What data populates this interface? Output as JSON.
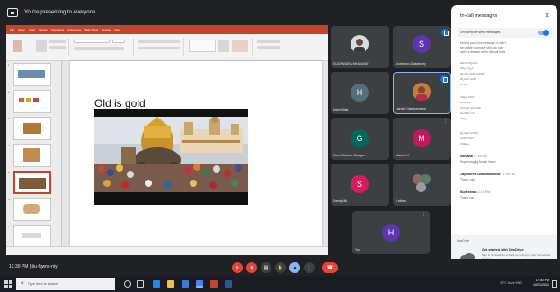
{
  "present_bar": {
    "text": "You're presenting to everyone"
  },
  "ppt": {
    "tabs": [
      "File",
      "Home",
      "Insert",
      "Design",
      "Transitions",
      "Animations",
      "Slide Show",
      "Review",
      "View"
    ],
    "thumb_numbers": [
      "1",
      "2",
      "3",
      "4",
      "5",
      "6",
      "7"
    ],
    "slide_title": "Old is gold"
  },
  "tiles": [
    {
      "id": "tile-0",
      "type": "photo",
      "name": "SUCHANDRA BHAGAVATI",
      "avatar_letter": "",
      "avatar_color": ""
    },
    {
      "id": "tile-1",
      "type": "letter",
      "name": "Sudeshna Chakraborty",
      "avatar_letter": "S",
      "avatar_color": "#5e35b1",
      "mic": true
    },
    {
      "id": "tile-2",
      "type": "letter",
      "name": "Harini Bhat",
      "avatar_letter": "H",
      "avatar_color": "#546e7a"
    },
    {
      "id": "tile-3",
      "type": "photo",
      "name": "Janaki Chandrashekar",
      "avatar_letter": "",
      "avatar_color": "",
      "mic": true,
      "highlight": true
    },
    {
      "id": "tile-4",
      "type": "letter",
      "name": "Gowri Shankar Bhargav",
      "avatar_letter": "G",
      "avatar_color": "#00695c"
    },
    {
      "id": "tile-5",
      "type": "letter",
      "name": "Mahesh K",
      "avatar_letter": "M",
      "avatar_color": "#c2185b"
    },
    {
      "id": "tile-6",
      "type": "letter",
      "name": "Sanay Nik",
      "avatar_letter": "S",
      "avatar_color": "#d81b60"
    },
    {
      "id": "tile-7",
      "type": "group",
      "name": "3 others",
      "avatar_letter": "",
      "avatar_color": ""
    },
    {
      "id": "tile-8",
      "type": "letter",
      "name": "You",
      "avatar_letter": "H",
      "avatar_color": "#5e35b1"
    }
  ],
  "chat": {
    "title": "In-call messages",
    "toggle_label": "Let everyone send messages",
    "messages_a": [
      "Unless you pin a message, it won't",
      "be visible to people who join later",
      "and it's deleted when the call ends"
    ],
    "messages_b": [
      "ಹಳೆಯ ಪದ್ಧತಿಗಳು",
      "ನಮ್ಮ ಸಂಸ್ಕೃತಿ",
      "ಹಬ್ಬಗಳು ಮತ್ತು ಆಚರಣೆ",
      "ಮೈಸೂರು ದಸರಾ",
      "ಅಂಬಾರಿ"
    ],
    "messages_c": [
      "ಜಮ್ಬೂ ಸವಾರಿ",
      "ಕಲಾವಿದರು",
      "ಗೋಲ್ಡನ್ ಚಾರಿಯಟ್",
      "ಸಾವಿರಾರು ಜನ",
      "ಹೆಮ್ಮೆ"
    ],
    "messages_d": [
      "ಮೈಸೂರು ಅರಮನೆ",
      "ದೀಪಾಲಂಕಾರ",
      "ನಾಡಹಬ್ಬ"
    ],
    "entries": [
      {
        "sender": "Sanjana",
        "time": "11:16 PM",
        "text": "Super singing buddy Harini"
      },
      {
        "sender": "Jayashree Chandrasekhar",
        "time": "11:16 PM",
        "text": "Thank you!"
      },
      {
        "sender": "Sudeshna",
        "time": "11:16 PM",
        "text": "Thank you"
      }
    ]
  },
  "notification": {
    "app": "OneDrive",
    "heading": "Get started with OneDrive",
    "body": "Sign in to OneDrive to back up and sync your files across devices"
  },
  "meet_bar": {
    "time": "12:30 PM",
    "divider": "|",
    "code": "tiu-fqwnc-niy"
  },
  "controls": [
    "mic",
    "camera",
    "captions",
    "raise-hand",
    "present",
    "more"
  ],
  "taskbar": {
    "search_placeholder": "Type here to search",
    "tray": "26°C Haze  ENG",
    "clock_time": "12:30 PM",
    "clock_date": "10/21/2021"
  }
}
